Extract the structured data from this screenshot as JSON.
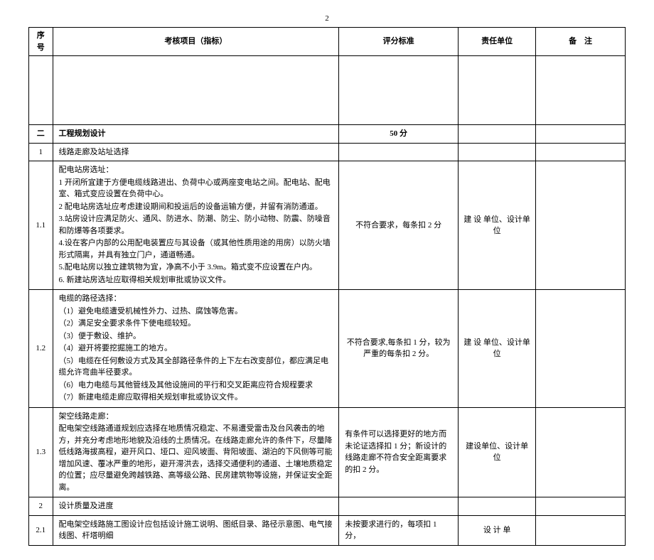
{
  "page_number": "2",
  "headers": {
    "seq": "序号",
    "item": "考核项目（指标）",
    "score": "评分标准",
    "resp": "责任单位",
    "note": "备　注"
  },
  "section2": {
    "seq": "二",
    "title": "工程规划设计",
    "score": "50 分"
  },
  "row1": {
    "seq": "1",
    "title": "线路走廊及站址选择"
  },
  "row1_1": {
    "seq": "1.1",
    "line0": "配电站房选址：",
    "line1": "1 开闭所宜建于方便电缆线路进出、负荷中心或两座变电站之间。配电站、配电室、箱式变应设置在负荷中心。",
    "line2": "2 配电站房选址应考虑建设期间和投运后的设备运输方便，并留有消防通道。",
    "line3": "3.站房设计应满足防火、通风、防进水、防潮、防尘、防小动物、防震、防噪音和防爆等各项要求。",
    "line4": "4.设在客户内部的公用配电装置应与其设备（或其他性质用途的用房）以防火墙形式隔离，并具有独立门户，通道畅通。",
    "line5": "5.配电站房以独立建筑物为宜，净高不小于 3.9m。箱式变不应设置在户内。",
    "line6": "6.  新建站房选址应取得相关规划审批或协议文件。",
    "score": "不符合要求，每条扣 2 分",
    "resp": "建 设 单位、设计单位"
  },
  "row1_2": {
    "seq": "1.2",
    "line0": "电缆的路径选择：",
    "line1": "（1）避免电缆遭受机械性外力、过热、腐蚀等危害。",
    "line2": "（2）满足安全要求条件下使电缆较短。",
    "line3": "（3）便于敷设、维护。",
    "line4": "（4）避开将要挖掘施工的地方。",
    "line5": "（5）电缆在任何敷设方式及其全部路径条件的上下左右改变部位，都应满足电缆允许弯曲半径要求。",
    "line6": "（6）电力电缆与其他管线及其他设施间的平行和交叉距离应符合规程要求",
    "line7": "（7）新建电缆走廊应取得相关规划审批或协议文件。",
    "score": "不符合要求,每条扣 1 分，较为严重的每条扣 2 分。",
    "resp": "建 设 单位、设计单位"
  },
  "row1_3": {
    "seq": "1.3",
    "line0": "架空线路走廊：",
    "line1": "配电架空线路通道规划应选择在地质情况稳定、不易遭受雷击及台风袭击的地方，并充分考虑地形地貌及沿线的土质情况。在线路走廊允许的条件下，尽量降低线路海拔高程，避开风口、垭口、迎风坡面、背阳坡面、湖泊的下风侧等可能增加风速、覆冰严重的地形，避开滞洪去，选择交通便利的通道、土壤地质稳定的位置；应尽量避免跨越铁路、高等级公路、民房建筑物等设施，并保证安全距离。",
    "score": "有条件可以选择更好的地方而未论证选择扣 1 分；新设计的线路走廊不符合安全距离要求的扣 2 分。",
    "resp": "建设单位、设计单位"
  },
  "row2": {
    "seq": "2",
    "title": "设计质量及进度"
  },
  "row2_1": {
    "seq": "2.1",
    "item": "配电架空线路施工图设计应包括设计施工说明、图纸目录、路径示意图、电气接线图、杆塔明细",
    "score": "未按要求进行的，每项扣 1 分，",
    "resp": "设 计 单"
  }
}
